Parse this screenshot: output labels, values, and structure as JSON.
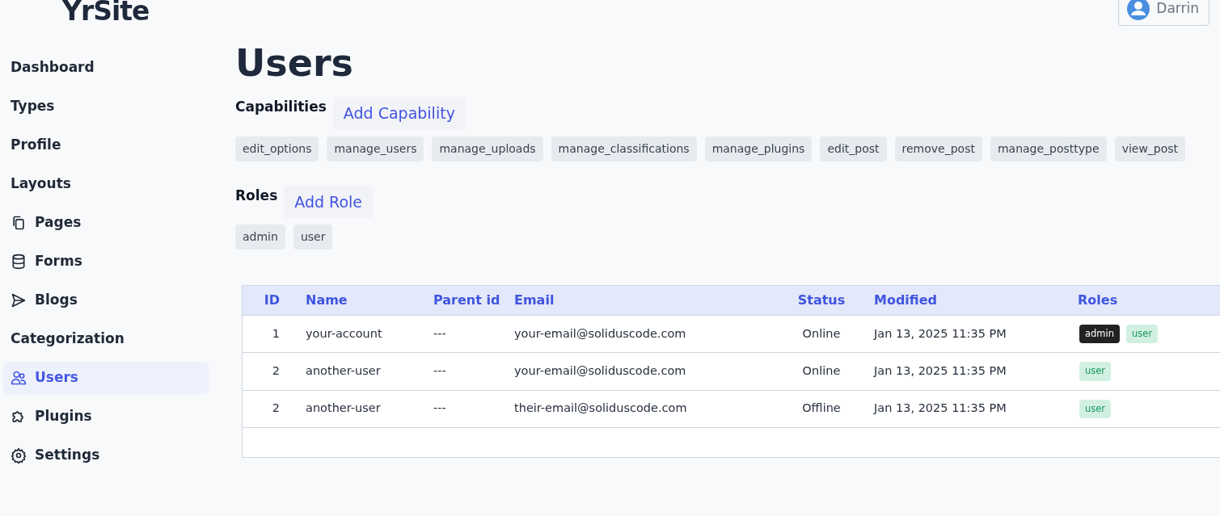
{
  "brand": "YrSite",
  "user_button": {
    "label": "Darrin"
  },
  "sidebar": {
    "items": [
      {
        "label": "Dashboard",
        "kind": "plain",
        "selected": false
      },
      {
        "label": "Types",
        "kind": "plain",
        "selected": false
      },
      {
        "label": "Profile",
        "kind": "plain",
        "selected": false
      },
      {
        "label": "Layouts",
        "kind": "plain",
        "selected": false
      },
      {
        "label": "Pages",
        "kind": "pages",
        "selected": false
      },
      {
        "label": "Forms",
        "kind": "forms",
        "selected": false
      },
      {
        "label": "Blogs",
        "kind": "blogs",
        "selected": false
      },
      {
        "label": "Categorization",
        "kind": "plain",
        "selected": false
      },
      {
        "label": "Users",
        "kind": "users",
        "selected": true
      },
      {
        "label": "Plugins",
        "kind": "plugins",
        "selected": false
      },
      {
        "label": "Settings",
        "kind": "settings",
        "selected": false
      }
    ]
  },
  "page_title": "Users",
  "capabilities": {
    "title": "Capabilities",
    "add_button": "Add Capability",
    "tags": [
      "edit_options",
      "manage_users",
      "manage_uploads",
      "manage_classifications",
      "manage_plugins",
      "edit_post",
      "remove_post",
      "manage_posttype",
      "view_post"
    ]
  },
  "roles": {
    "title": "Roles",
    "add_button": "Add Role",
    "tags": [
      "admin",
      "user"
    ]
  },
  "table": {
    "columns": [
      "ID",
      "Name",
      "Parent id",
      "Email",
      "Status",
      "Modified",
      "Roles"
    ],
    "rows": [
      {
        "id": "1",
        "name": "your-account",
        "parent": "---",
        "email": "your-email@soliduscode.com",
        "status": "Online",
        "modified": "Jan 13, 2025 11:35 PM",
        "roles": [
          {
            "label": "admin",
            "kind": "admin"
          },
          {
            "label": "user",
            "kind": "user"
          }
        ]
      },
      {
        "id": "2",
        "name": "another-user",
        "parent": "---",
        "email": "your-email@soliduscode.com",
        "status": "Online",
        "modified": "Jan 13, 2025 11:35 PM",
        "roles": [
          {
            "label": "user",
            "kind": "user"
          }
        ]
      },
      {
        "id": "2",
        "name": "another-user",
        "parent": "---",
        "email": "their-email@soliduscode.com",
        "status": "Offline",
        "modified": "Jan 13, 2025 11:35 PM",
        "roles": [
          {
            "label": "user",
            "kind": "user"
          }
        ]
      }
    ]
  }
}
